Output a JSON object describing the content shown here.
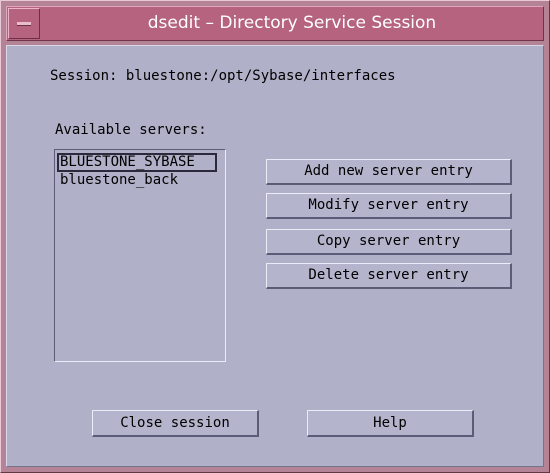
{
  "window": {
    "title": "dsedit – Directory Service Session"
  },
  "session": {
    "label": "Session: bluestone:/opt/Sybase/interfaces"
  },
  "servers": {
    "heading": "Available servers:",
    "items": [
      {
        "label": "BLUESTONE_SYBASE",
        "selected": true
      },
      {
        "label": "bluestone_back",
        "selected": false
      }
    ]
  },
  "actions": {
    "add": "Add new server entry",
    "modify": "Modify server entry",
    "copy": "Copy server entry",
    "delete": "Delete server entry"
  },
  "footer": {
    "close": "Close session",
    "help": "Help"
  },
  "colors": {
    "title_bar": "#b5637f",
    "frame": "#b48396",
    "client_bg": "#b0b0c8"
  }
}
